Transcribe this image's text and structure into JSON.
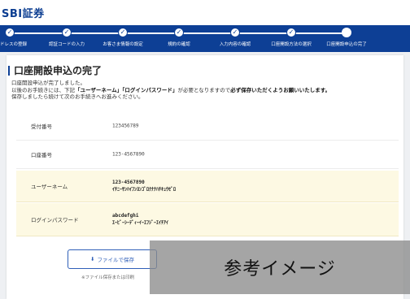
{
  "header": {
    "logo_text": "SBI証券"
  },
  "stepper": {
    "steps": [
      {
        "label": "ドレスの登録"
      },
      {
        "label": "認証コードの入力"
      },
      {
        "label": "お客さま情報の設定"
      },
      {
        "label": "規約の確認"
      },
      {
        "label": "入力内容の確認"
      },
      {
        "label": "口座開設方法の選択"
      },
      {
        "label": "口座開設申込の完了"
      }
    ],
    "check_glyph": "✓"
  },
  "main": {
    "title": "口座開設申込の完了",
    "notice": {
      "line1": "口座開設申込が完了しました。",
      "line2_a": "以後のお手続きには、下記",
      "line2_b": "「ユーザーネーム」「ログインパスワード」",
      "line2_c": "が必要となりますので",
      "line2_d": "必ず保存いただくようお願いいたします。",
      "line3": "保存しましたら続けて次のお手続きへお進みください。"
    },
    "rows": [
      {
        "label": "受付番号",
        "value": "123456789"
      },
      {
        "label": "口座番号",
        "value": "123-4567890"
      },
      {
        "label": "ユーザーネーム",
        "value": "123-4567890",
        "value2": "ｲﾁﾆｰｻﾝﾊｲﾌﾝﾖﾝｺﾞﾛｸﾅﾅﾊﾁｷｭｳｾﾞﾛ"
      },
      {
        "label": "ログインパスワード",
        "value": "abcdefghi",
        "value2": "ｴｰﾋﾞｰｼｰﾃﾞｨｰｲｰｴﾌｼﾞｰｴｲﾁｱｲ"
      }
    ],
    "save_button": {
      "icon": "⬇",
      "label": "ファイルで保存"
    },
    "footnote": "※ファイル保存または印刷"
  },
  "overlay": {
    "text": "参考イメージ"
  }
}
